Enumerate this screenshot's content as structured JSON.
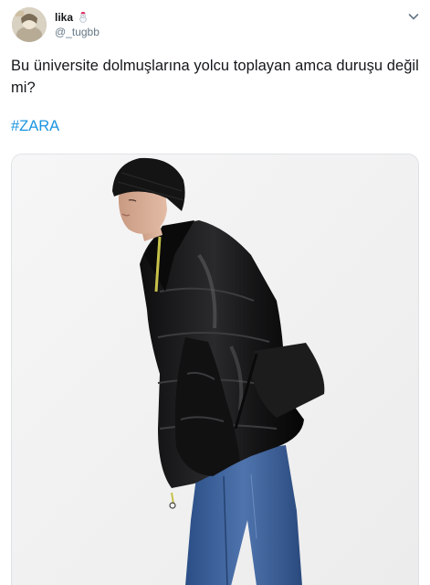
{
  "tweet": {
    "user": {
      "display_name": "lika",
      "name_emoji": "snowman-emoji-icon",
      "handle": "@_tugbb"
    },
    "text": "Bu üniversite dolmuşlarına yolcu toplayan amca duruşu değil mi?",
    "hashtag": "#ZARA",
    "colors": {
      "text": "#14171a",
      "secondary": "#657786",
      "link": "#1b95e0",
      "background": "#ffffff"
    },
    "media": {
      "icon": "photo-model-puffer-jacket"
    }
  }
}
